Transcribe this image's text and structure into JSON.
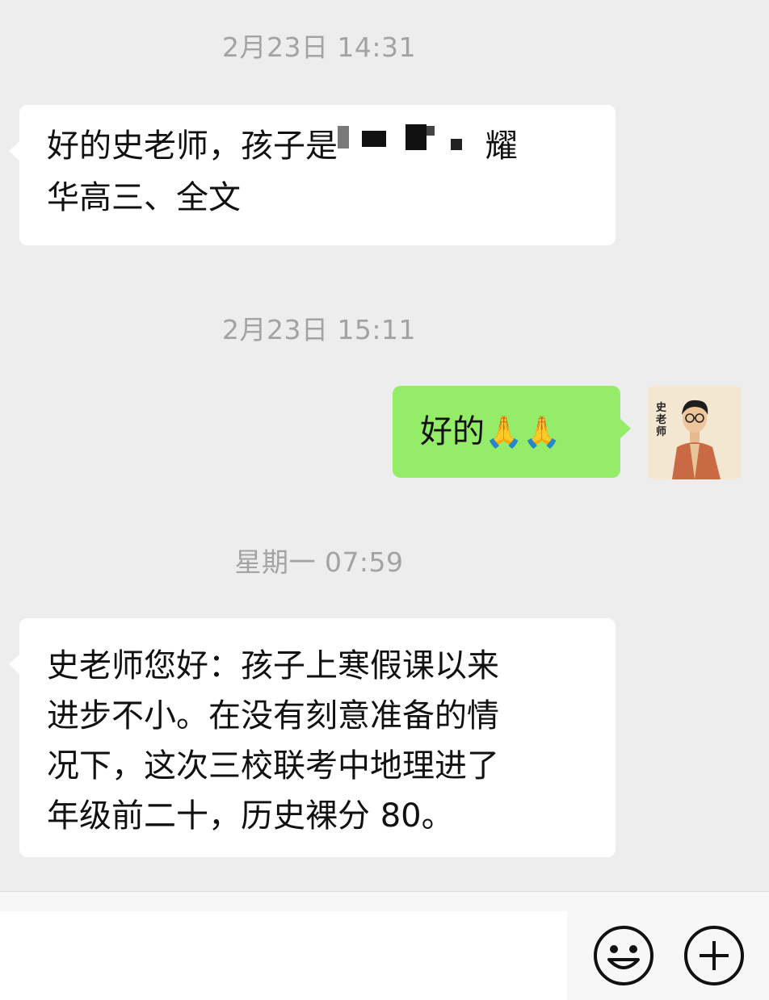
{
  "chat": {
    "timestamps": [
      "2月23日 14:31",
      "2月23日 15:11",
      "星期一 07:59"
    ],
    "message1": {
      "line1_start": "好的史老师，孩子是",
      "line1_end": "耀",
      "line2": "华高三、全文"
    },
    "message2": {
      "text": "好的",
      "emoji": "🙏🙏"
    },
    "avatar_text": "史老师",
    "message3": {
      "lines": [
        "史老师您好：孩子上寒假课以来",
        "进步不小。在没有刻意准备的情",
        "况下，这次三校联考中地理进了",
        "年级前二十，历史裸分 80。"
      ]
    }
  },
  "input_bar": {
    "icons": [
      "emoji-icon",
      "plus-icon"
    ]
  }
}
